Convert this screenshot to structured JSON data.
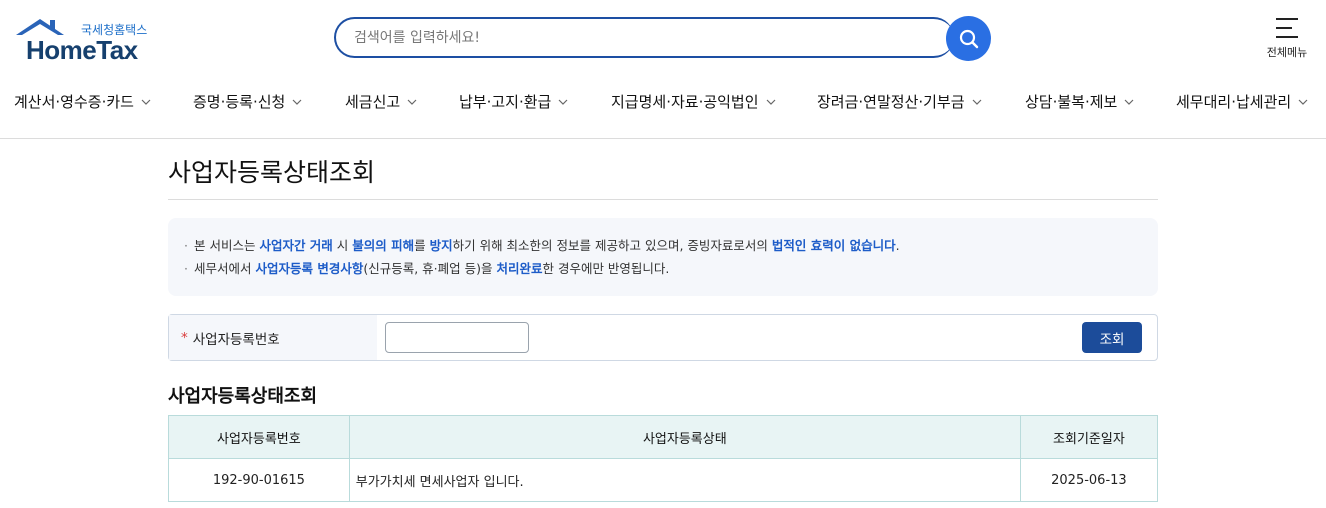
{
  "logo": {
    "sub": "국세청홈택스",
    "main": "HomeTax"
  },
  "search": {
    "placeholder": "검색어를 입력하세요!"
  },
  "header": {
    "all_menu_label": "전체메뉴"
  },
  "gnb": [
    {
      "label": "계산서·영수증·카드"
    },
    {
      "label": "증명·등록·신청"
    },
    {
      "label": "세금신고"
    },
    {
      "label": "납부·고지·환급"
    },
    {
      "label": "지급명세·자료·공익법인"
    },
    {
      "label": "장려금·연말정산·기부금"
    },
    {
      "label": "상담·불복·제보"
    },
    {
      "label": "세무대리·납세관리"
    }
  ],
  "page": {
    "title": "사업자등록상태조회"
  },
  "notice": {
    "line1": {
      "t1": "본 서비스는 ",
      "h1": "사업자간 거래",
      "t2": " 시 ",
      "h2": "불의의 피해",
      "t3": "를 ",
      "h3": "방지",
      "t4": "하기 위해 최소한의 정보를 제공하고 있으며, 증빙자료로서의 ",
      "h4": "법적인 효력이 없습니다",
      "t5": "."
    },
    "line2": {
      "t1": "세무서에서 ",
      "h1": "사업자등록 변경사항",
      "t2": "(신규등록, 휴·폐업 등)을 ",
      "h2": "처리완료",
      "t3": "한 경우에만 반영됩니다."
    }
  },
  "form": {
    "required_mark": "*",
    "label": "사업자등록번호",
    "value": "",
    "submit_label": "조회"
  },
  "result": {
    "title": "사업자등록상태조회",
    "columns": [
      "사업자등록번호",
      "사업자등록상태",
      "조회기준일자"
    ],
    "rows": [
      [
        "192-90-01615",
        "부가가치세 면세사업자 입니다.",
        "2025-06-13"
      ]
    ]
  },
  "colors": {
    "brand_blue": "#1d4fa3",
    "search_btn": "#2a6fe3",
    "highlight": "#1d5cc8",
    "table_head": "#e8f4f4"
  }
}
